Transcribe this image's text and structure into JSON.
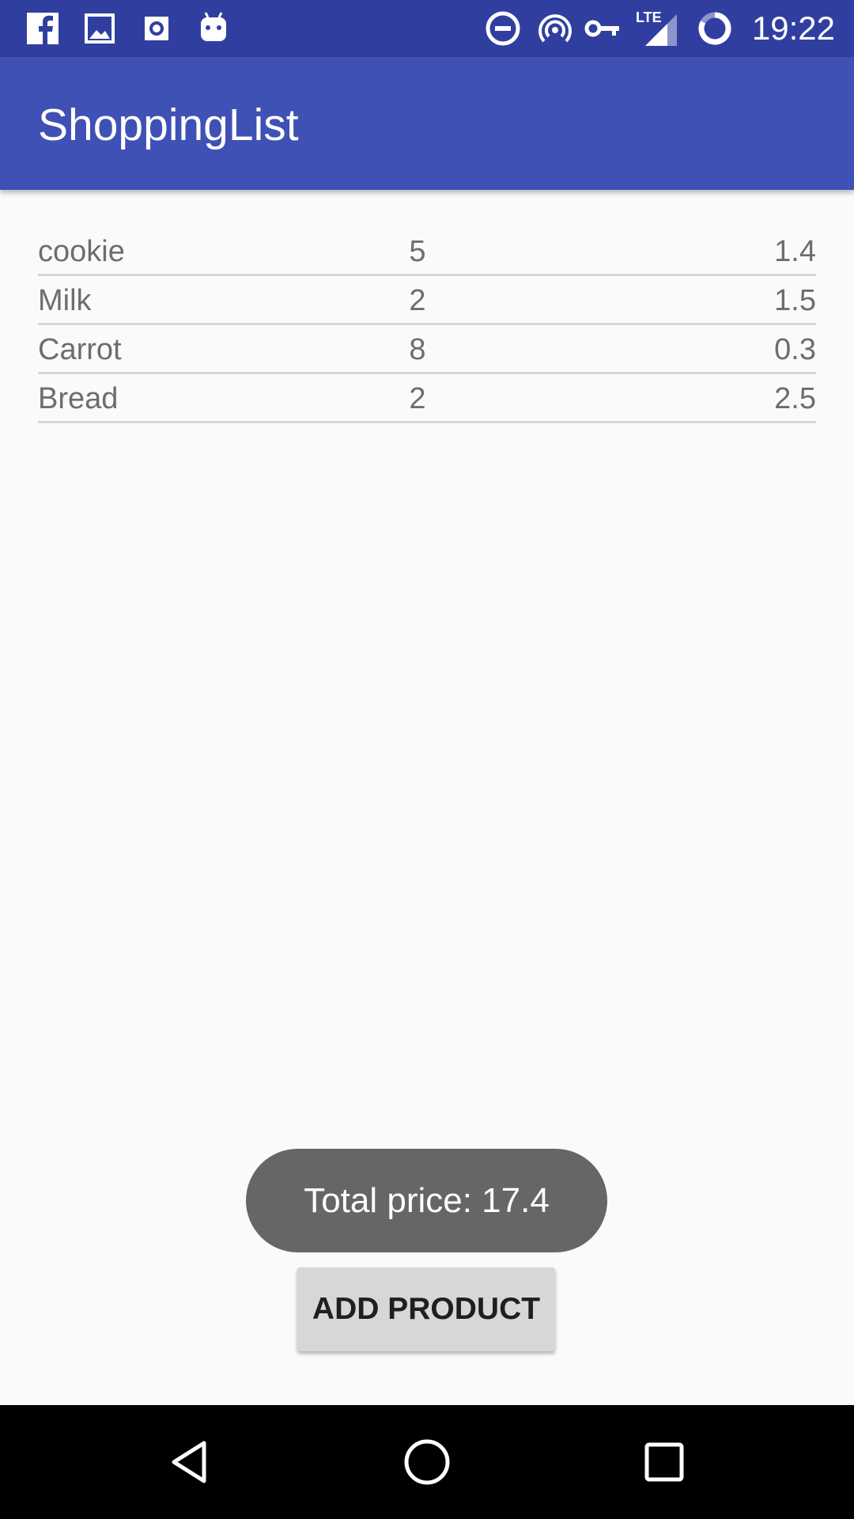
{
  "status_bar": {
    "time": "19:22",
    "network_label": "LTE",
    "left_icons": [
      "facebook-icon",
      "gallery-icon",
      "outlook-icon",
      "android-icon"
    ],
    "right_icons": [
      "do-not-disturb-icon",
      "hotspot-icon",
      "vpn-key-icon",
      "lte-signal-icon",
      "battery-icon"
    ]
  },
  "app_bar": {
    "title": "ShoppingList"
  },
  "products": [
    {
      "name": "cookie",
      "quantity": "5",
      "price": "1.4"
    },
    {
      "name": "Milk",
      "quantity": "2",
      "price": "1.5"
    },
    {
      "name": "Carrot",
      "quantity": "8",
      "price": "0.3"
    },
    {
      "name": "Bread",
      "quantity": "2",
      "price": "2.5"
    }
  ],
  "toast": {
    "text": "Total price: 17.4"
  },
  "actions": {
    "add_product_label": "ADD PRODUCT"
  },
  "nav_bar": {
    "buttons": [
      "back-icon",
      "home-icon",
      "recents-icon"
    ]
  },
  "colors": {
    "status_bar": "#303f9f",
    "app_bar": "#3f51b5",
    "background": "#fafafa",
    "toast": "#666666",
    "button": "#d6d7d7"
  }
}
